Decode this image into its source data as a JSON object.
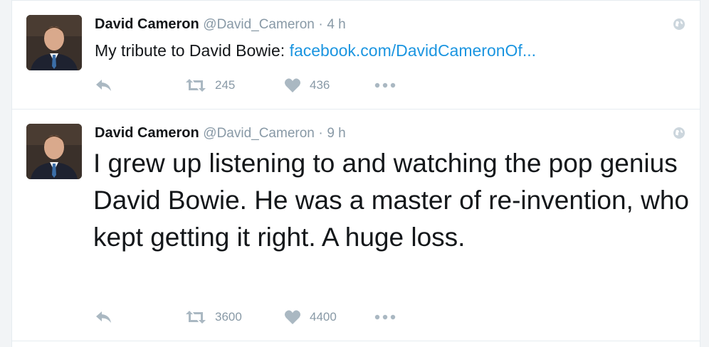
{
  "tweets": [
    {
      "name": "David Cameron",
      "handle": "@David_Cameron",
      "separator": "·",
      "time": "4 h",
      "text": "My tribute to David Bowie: ",
      "link": "facebook.com/DavidCameronOf...",
      "retweets": "245",
      "likes": "436"
    },
    {
      "name": "David Cameron",
      "handle": "@David_Cameron",
      "separator": "·",
      "time": "9 h",
      "text": "I grew up listening to and watching the pop genius David Bowie. He was a master of re-invention, who kept getting it right. A huge loss.",
      "retweets": "3600",
      "likes": "4400"
    }
  ],
  "colors": {
    "text": "#14171a",
    "muted": "#8899a6",
    "link": "#1b95e0",
    "icon": "#aab8c2",
    "border": "#e6ecf0"
  },
  "icons": [
    "avatar",
    "globe-icon",
    "reply-icon",
    "retweet-icon",
    "heart-icon",
    "more-icon"
  ]
}
